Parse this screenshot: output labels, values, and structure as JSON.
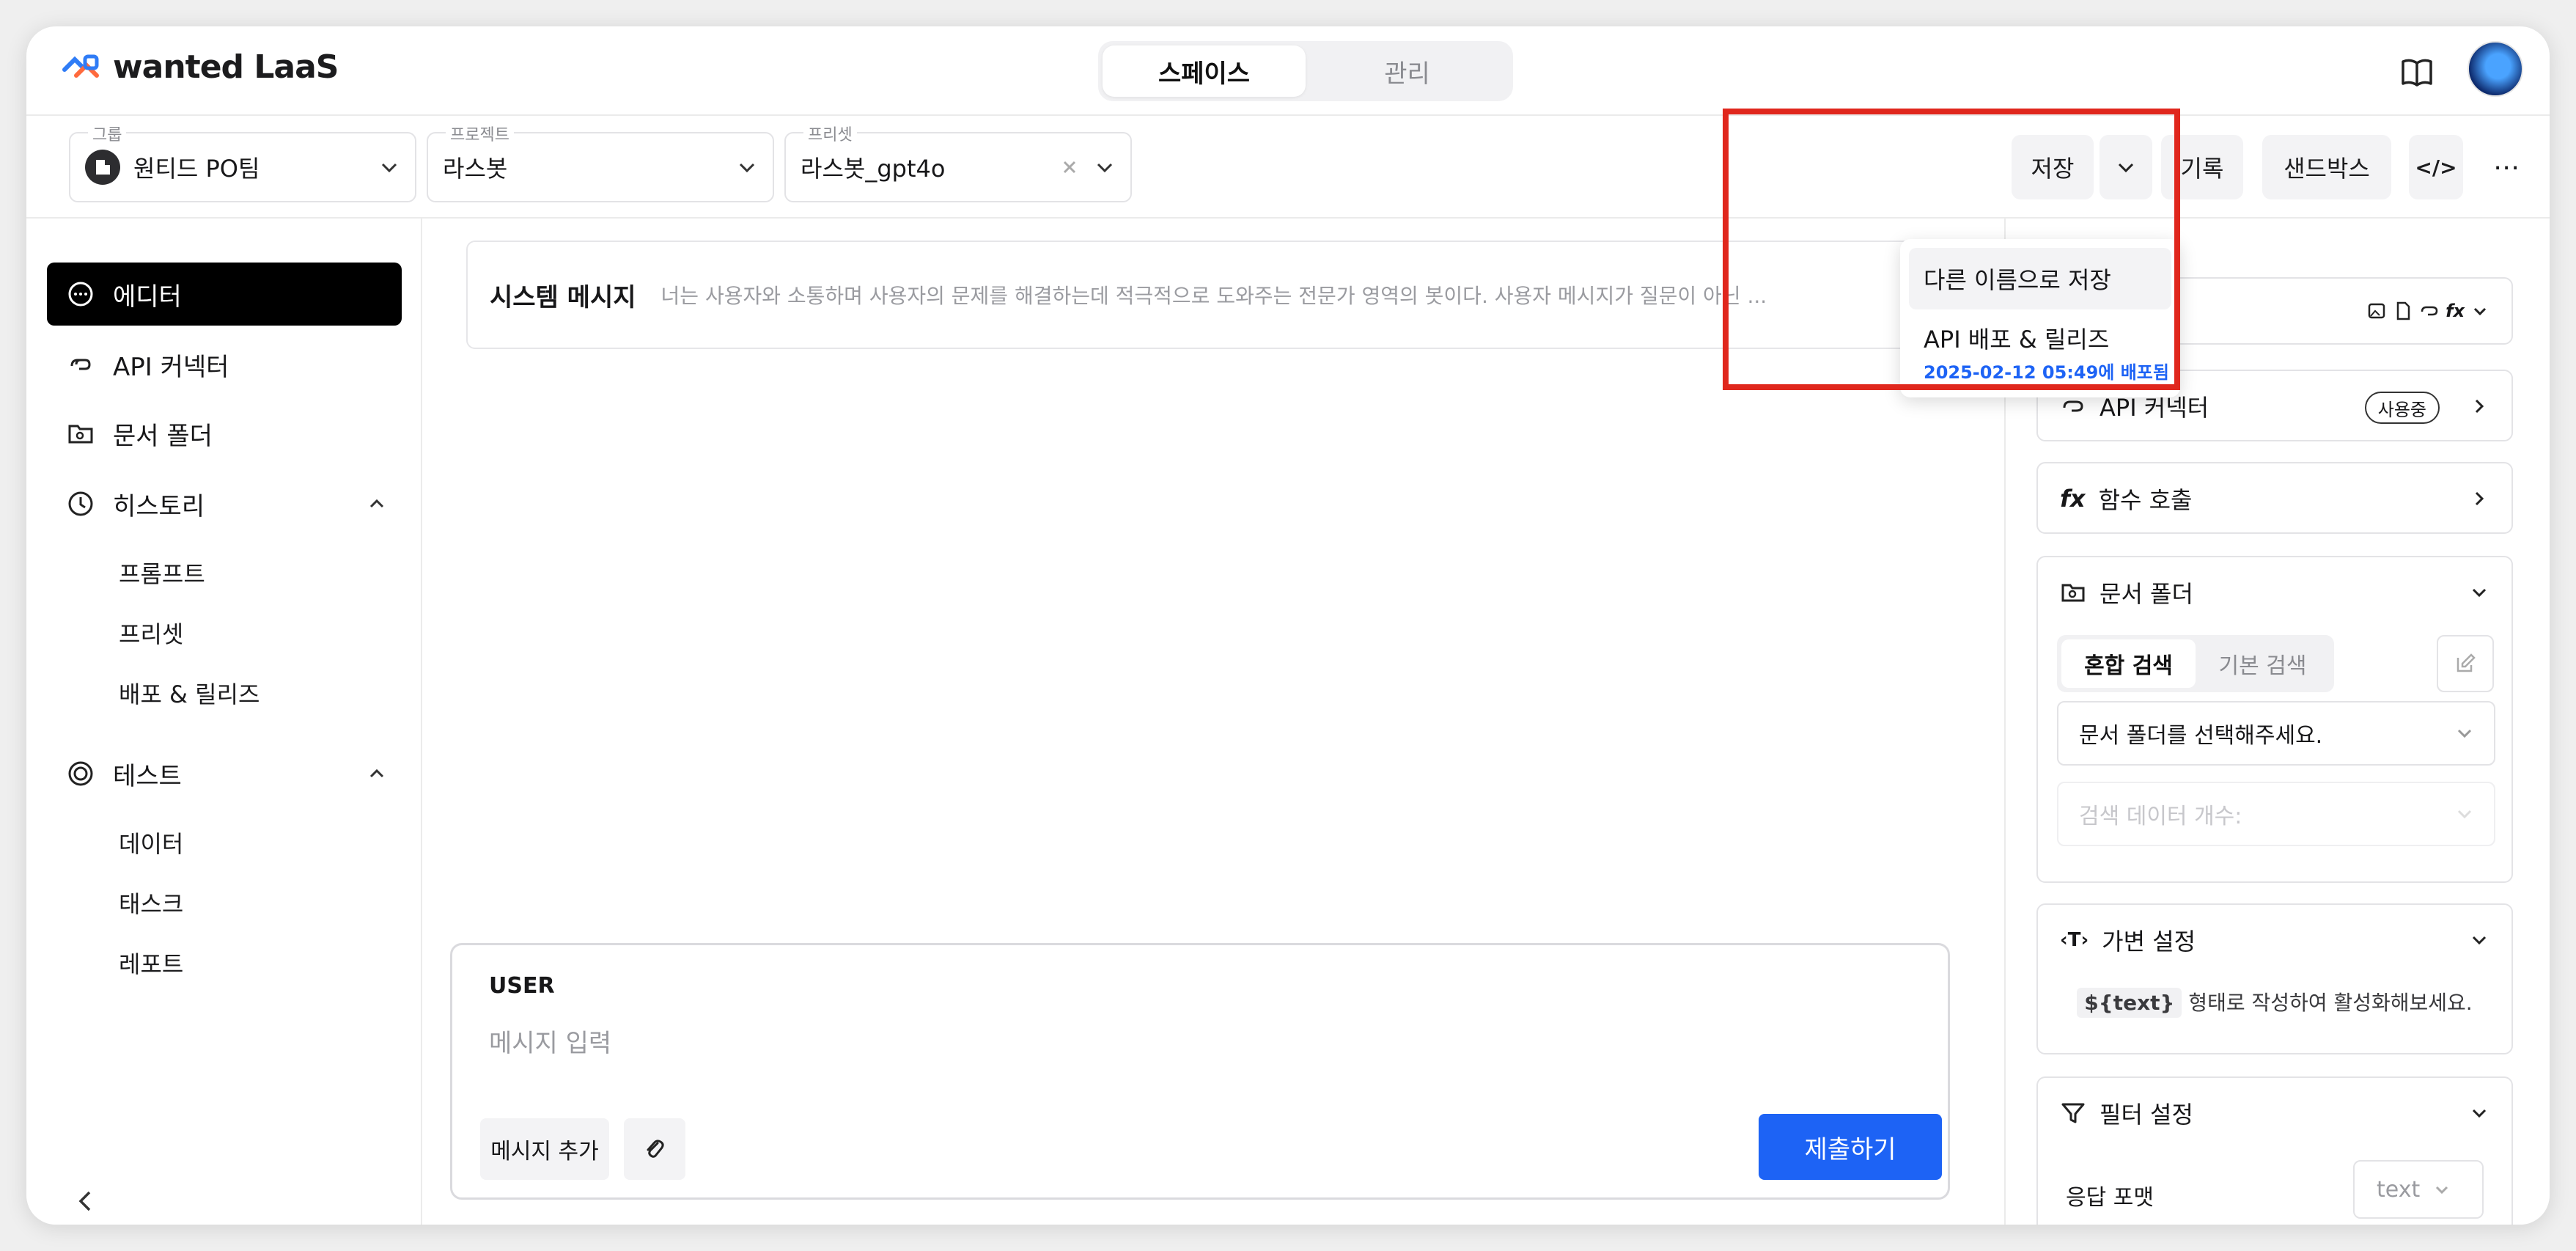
{
  "app": {
    "brand": "wanted LaaS"
  },
  "topnav": {
    "tabs": [
      "스페이스",
      "관리"
    ],
    "active": "스페이스"
  },
  "toolbar": {
    "group": {
      "label": "그룹",
      "value": "원티드 PO팀"
    },
    "project": {
      "label": "프로젝트",
      "value": "라스봇"
    },
    "preset": {
      "label": "프리셋",
      "value": "라스봇_gpt4o"
    },
    "save_label": "저장",
    "history_label": "기록",
    "sandbox_label": "샌드박스",
    "code_label": "</>"
  },
  "save_menu": {
    "save_as": "다른 이름으로 저장",
    "deploy": "API 배포 & 릴리즈",
    "deployed_at": "2025-02-12 05:49에 배포됨"
  },
  "sidebar": {
    "items": [
      {
        "label": "에디터",
        "icon": "chat-icon",
        "active": true
      },
      {
        "label": "API 커넥터",
        "icon": "link-icon"
      },
      {
        "label": "문서 폴더",
        "icon": "folder-search-icon"
      },
      {
        "label": "히스토리",
        "icon": "clock-icon",
        "expanded": true,
        "children": [
          "프롬프트",
          "프리셋",
          "배포 & 릴리즈"
        ]
      },
      {
        "label": "테스트",
        "icon": "target-icon",
        "expanded": true,
        "children": [
          "데이터",
          "태스크",
          "레포트"
        ]
      }
    ]
  },
  "editor": {
    "system_title": "시스템 메시지",
    "system_text": "너는 사용자와 소통하며 사용자의 문제를 해결하는데 적극적으로 도와주는 전문가 영역의 봇이다. 사용자 메시지가 질문이 아닌 ...",
    "composer": {
      "role": "USER",
      "placeholder": "메시지 입력",
      "add_label": "메시지 추가",
      "submit_label": "제출하기"
    }
  },
  "right_panel": {
    "api_connector": {
      "label": "API 커넥터",
      "badge": "사용중"
    },
    "function_call": {
      "label": "함수 호출"
    },
    "doc_folder": {
      "label": "문서 폴더",
      "modes": [
        "혼합 검색",
        "기본 검색"
      ],
      "active_mode": "혼합 검색",
      "select_placeholder": "문서 폴더를 선택해주세요.",
      "count_placeholder": "검색 데이터 개수:"
    },
    "variables": {
      "label": "가변 설정",
      "code": "${text}",
      "hint": "형태로 작성하여 활성화해보세요."
    },
    "filter": {
      "label": "필터 설정",
      "format_label": "응답 포맷",
      "format_value": "text"
    }
  },
  "colors": {
    "primary": "#1d63f5",
    "highlight": "#e0271d"
  }
}
